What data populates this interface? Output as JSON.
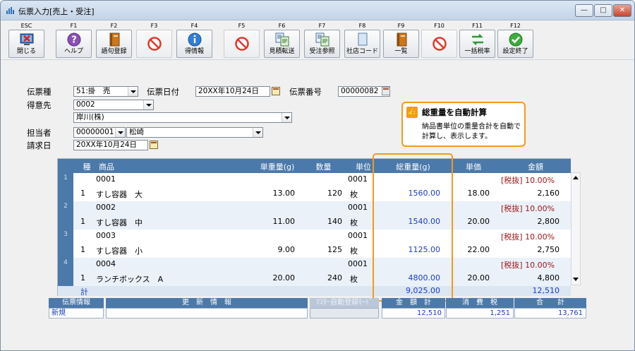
{
  "window": {
    "title": "伝票入力[売上・受注]"
  },
  "toolbar": {
    "keys": [
      "ESC",
      "F1",
      "F2",
      "F3",
      "F4",
      "F5",
      "F6",
      "F7",
      "F8",
      "F9",
      "F10",
      "F11",
      "F12"
    ],
    "buttons": [
      {
        "key": "ESC",
        "label": "閉じる",
        "icon": "close-window-icon"
      },
      {
        "key": "F1",
        "label": "ヘルプ",
        "icon": "help-icon"
      },
      {
        "key": "F2",
        "label": "語句登録",
        "icon": "book-icon"
      },
      {
        "key": "F3",
        "label": "",
        "icon": "no-entry-icon"
      },
      {
        "key": "F4",
        "label": "得情報",
        "icon": "info-icon"
      },
      {
        "key": "F5",
        "label": "",
        "icon": "no-entry-icon"
      },
      {
        "key": "F6",
        "label": "見積転送",
        "icon": "transfer-icon"
      },
      {
        "key": "F7",
        "label": "受注参照",
        "icon": "reference-icon"
      },
      {
        "key": "F8",
        "label": "社店コード",
        "icon": "document-icon"
      },
      {
        "key": "F9",
        "label": "一覧",
        "icon": "list-book-icon"
      },
      {
        "key": "F10",
        "label": "",
        "icon": "no-entry-icon"
      },
      {
        "key": "F11",
        "label": "一括税率",
        "icon": "arrows-icon"
      },
      {
        "key": "F12",
        "label": "設定終了",
        "icon": "check-icon"
      }
    ]
  },
  "form": {
    "voucher_type_label": "伝票種",
    "voucher_type_value": "51:掛　売",
    "voucher_date_label": "伝票日付",
    "voucher_date_value": "20XX年10月24日",
    "voucher_no_label": "伝票番号",
    "voucher_no_value": "00000082",
    "customer_label": "得意先",
    "customer_code": "0002",
    "customer_name": "岸川(株)",
    "staff_label": "担当者",
    "staff_code": "00000001",
    "staff_name": "松崎",
    "billing_date_label": "請求日",
    "billing_date_value": "20XX年10月24日"
  },
  "callout": {
    "title": "総重量を自動計算",
    "body": "納品書単位の重量合計を自動で計算し、表示します。"
  },
  "grid": {
    "headers": [
      "種",
      "商品",
      "単重量(g)",
      "数量",
      "単位",
      "総重量(g)",
      "単価",
      "金額"
    ],
    "rows": [
      {
        "index": "1",
        "type": "1",
        "code": "0001",
        "name": "すし容器　大",
        "unit_weight": "13.00",
        "qty": "120",
        "unit_code": "0001",
        "unit": "枚",
        "total_weight": "1560.00",
        "price": "18.00",
        "tax": "[税抜] 10.00%",
        "amount": "2,160"
      },
      {
        "index": "2",
        "type": "1",
        "code": "0002",
        "name": "すし容器　中",
        "unit_weight": "11.00",
        "qty": "140",
        "unit_code": "0001",
        "unit": "枚",
        "total_weight": "1540.00",
        "price": "20.00",
        "tax": "[税抜] 10.00%",
        "amount": "2,800"
      },
      {
        "index": "3",
        "type": "1",
        "code": "0003",
        "name": "すし容器　小",
        "unit_weight": "9.00",
        "qty": "125",
        "unit_code": "0001",
        "unit": "枚",
        "total_weight": "1125.00",
        "price": "22.00",
        "tax": "[税抜] 10.00%",
        "amount": "2,750"
      },
      {
        "index": "4",
        "type": "1",
        "code": "0004",
        "name": "ランチボックス　A",
        "unit_weight": "20.00",
        "qty": "240",
        "unit_code": "0001",
        "unit": "枚",
        "total_weight": "4800.00",
        "price": "20.00",
        "tax": "[税抜] 10.00%",
        "amount": "4,800"
      }
    ],
    "total_label": "計",
    "total_weight": "9,025.00",
    "total_amount": "12,510"
  },
  "footer": {
    "info_label": "伝票情報",
    "info_value": "新規",
    "update_label": "更　新　情　報",
    "update_value": "",
    "master_label": "ﾏｽﾀｰ自動登録ﾓｰﾄﾞ",
    "amount_label": "金　額　計",
    "amount_value": "12,510",
    "tax_label": "消　費　税",
    "tax_value": "1,251",
    "total_label": "合　　計",
    "total_value": "13,761"
  }
}
